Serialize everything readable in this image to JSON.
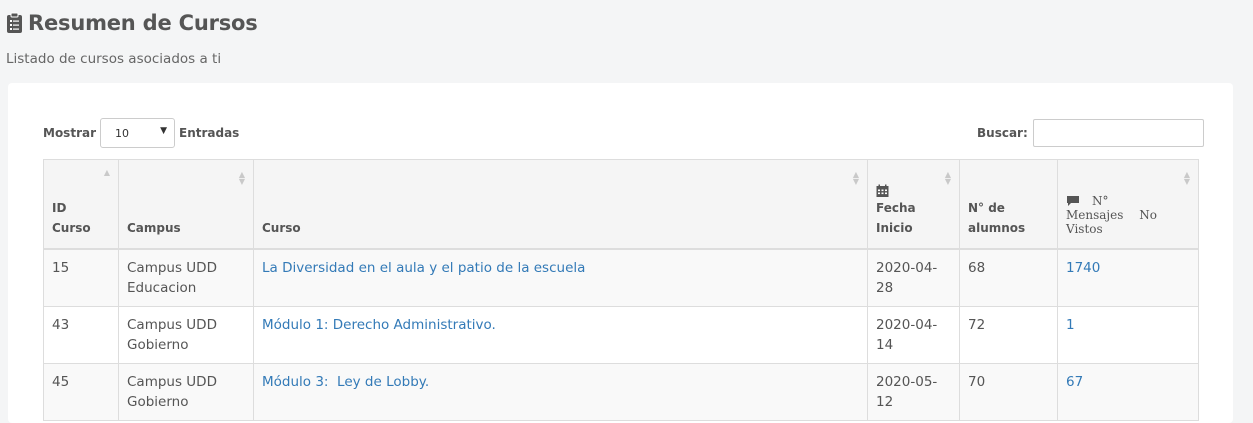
{
  "header": {
    "title": "Resumen de Cursos",
    "subtitle": "Listado de cursos asociados a ti"
  },
  "controls": {
    "length_label_before": "Mostrar",
    "length_value": "10",
    "length_label_after": "Entradas",
    "search_label": "Buscar:",
    "search_value": ""
  },
  "table": {
    "columns": {
      "id": [
        "ID",
        "Curso"
      ],
      "campus": "Campus",
      "curso": "Curso",
      "fecha": [
        "Fecha",
        "Inicio"
      ],
      "alumnos": [
        "N° de",
        "alumnos"
      ],
      "mensajes": [
        "N°",
        "Mensajes No",
        "Vistos"
      ]
    },
    "rows": [
      {
        "id": "15",
        "campus": [
          "Campus UDD",
          "Educacion"
        ],
        "curso": "La Diversidad en el aula y el patio de la escuela",
        "fecha": [
          "2020-04-",
          "28"
        ],
        "alumnos": "68",
        "mensajes": "1740"
      },
      {
        "id": "43",
        "campus": [
          "Campus UDD",
          "Gobierno"
        ],
        "curso": "Módulo 1: Derecho Administrativo.",
        "fecha": [
          "2020-04-",
          "14"
        ],
        "alumnos": "72",
        "mensajes": "1"
      },
      {
        "id": "45",
        "campus": [
          "Campus UDD",
          "Gobierno"
        ],
        "curso": "Módulo 3:  Ley de Lobby.",
        "fecha": [
          "2020-05-",
          "12"
        ],
        "alumnos": "70",
        "mensajes": "67"
      }
    ]
  },
  "icons": {
    "title": "clipboard-list-icon",
    "fecha": "calendar-icon",
    "mensajes": "comment-icon",
    "sort": "sort-icon"
  },
  "colors": {
    "link": "#337ab7",
    "header_bg": "#f5f5f5",
    "stripe": "#f9f9f9",
    "page_bg": "#f4f5f6"
  }
}
